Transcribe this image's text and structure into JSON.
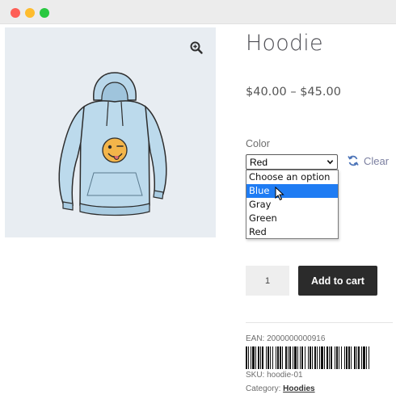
{
  "window": {
    "controls": [
      "close",
      "minimize",
      "maximize"
    ]
  },
  "product": {
    "title": "Hoodie",
    "price": "$40.00 – $45.00",
    "image_icon": "hoodie-image",
    "zoom_icon": "zoom-in-icon"
  },
  "variation": {
    "label": "Color",
    "selected": "Red",
    "options": [
      "Choose an option",
      "Blue",
      "Gray",
      "Green",
      "Red"
    ],
    "highlighted": "Blue",
    "clear_label": "Clear",
    "clear_icon": "refresh-icon"
  },
  "cart": {
    "quantity": "1",
    "add_label": "Add to cart"
  },
  "meta": {
    "ean": "EAN: 2000000000916",
    "sku": "SKU: hoodie-01",
    "category_prefix": "Category: ",
    "category": "Hoodies"
  },
  "colors": {
    "accent_blue": "#1f7cf3",
    "button_dark": "#2b2b2b",
    "clear_link": "#7b7fa0"
  }
}
